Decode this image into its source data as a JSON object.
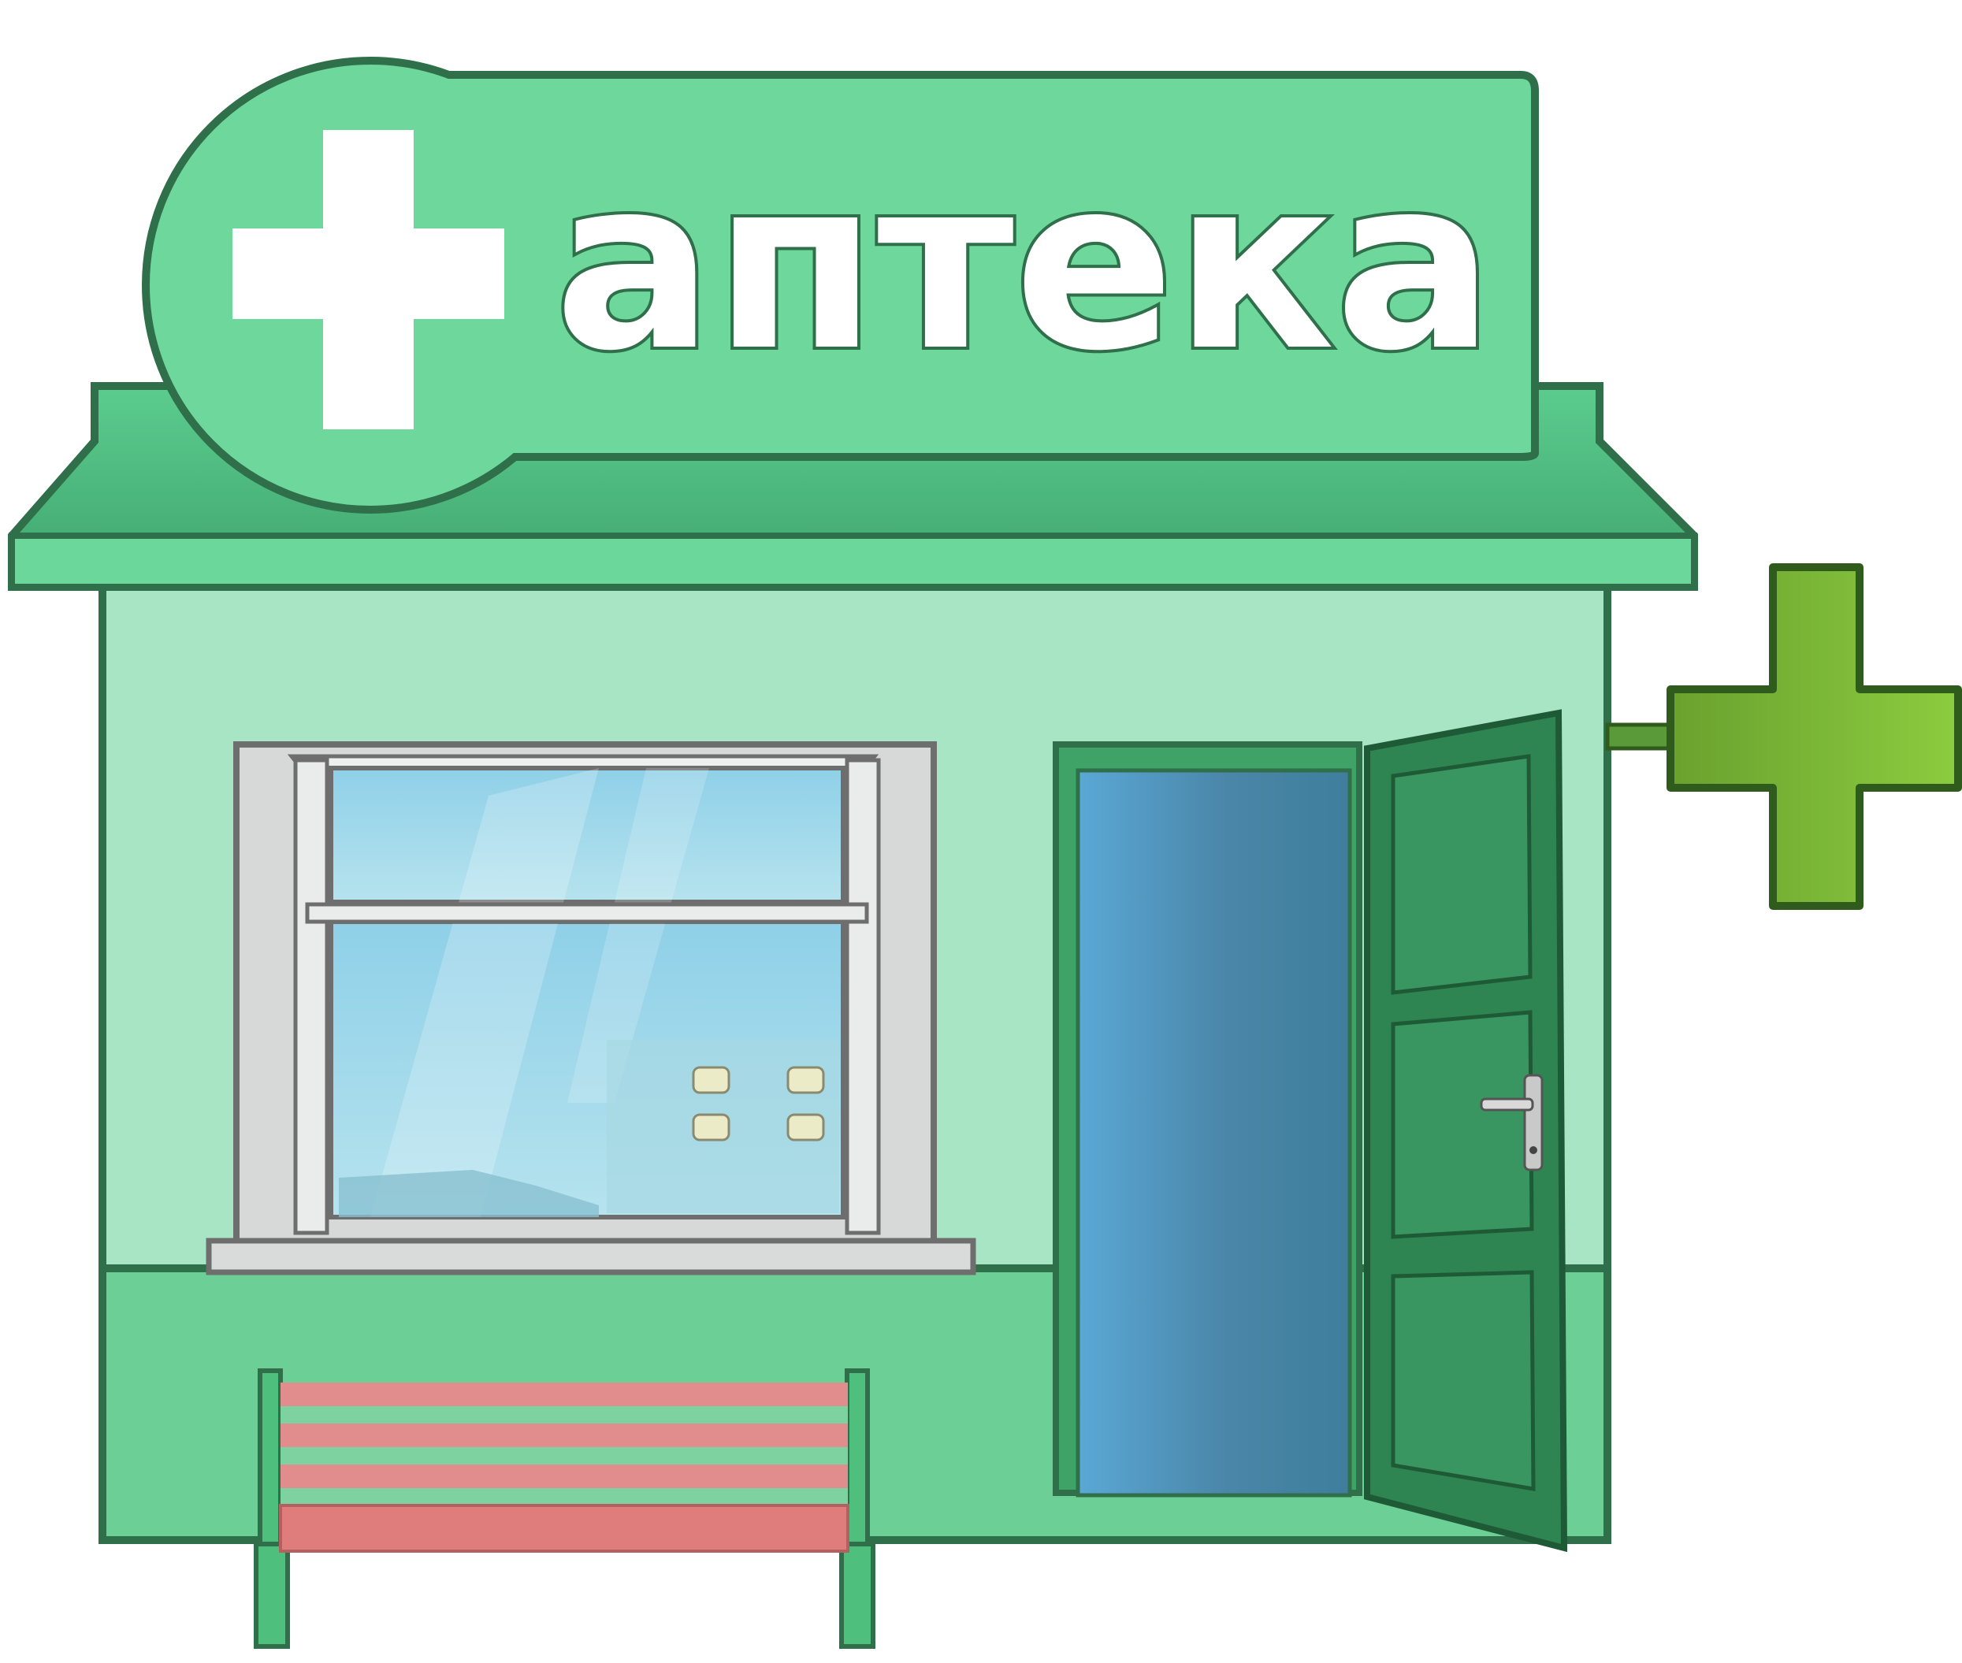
{
  "sign": {
    "text": "аптека"
  },
  "colors": {
    "sign_green": "#6dd79c",
    "sign_dark": "#44a873",
    "wall_light": "#a9e6c6",
    "wall_band": "#6bcf95",
    "outline_dark": "#2f6f4a",
    "door_green": "#2f8552",
    "doorway_blue": "#4a8fb3",
    "glass_blue": "#9ad3e6",
    "bench_stripe_pink": "#e28a8a",
    "bench_stripe_green": "#7ed2a0",
    "side_cross_green": "#7ab23a"
  }
}
